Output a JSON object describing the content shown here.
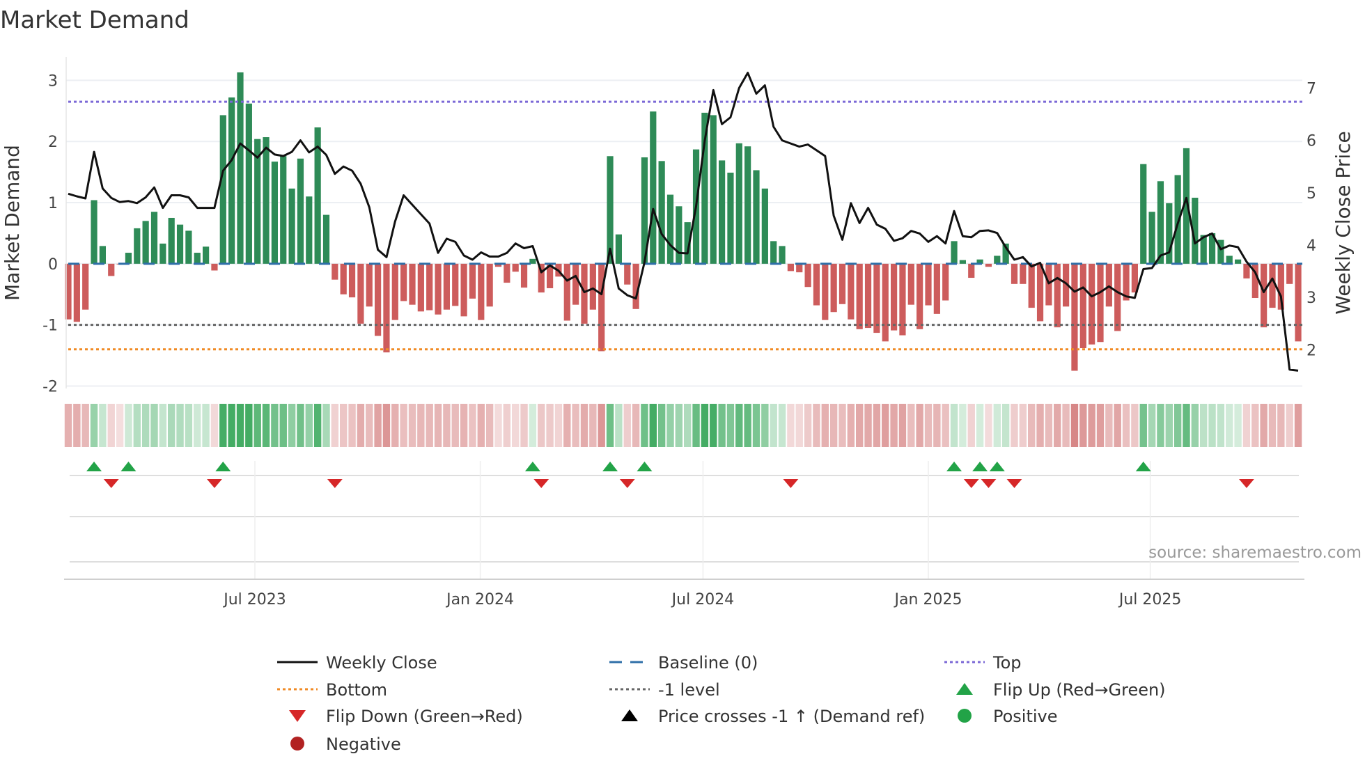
{
  "title": "Market Demand",
  "source": "source: sharemaestro.com",
  "colors": {
    "positive": "#2e8b57",
    "negative": "#cd5c5c",
    "price": "#111111",
    "top": "#7b68d6",
    "bottom": "#f08a24",
    "minus1": "#666666",
    "baseline": "#2f6fa8",
    "flip_up": "#22a347",
    "flip_down": "#d62728",
    "neg_dot": "#b22222"
  },
  "chart_data": {
    "type": "bar",
    "title": "Market Demand",
    "ylabel": "Market Demand",
    "y2label": "Weekly Close Price",
    "ylim": [
      -2.04,
      3.38
    ],
    "y2lim": [
      1.26,
      7.59
    ],
    "yticks": [
      "-2",
      "-1",
      "0",
      "1",
      "2",
      "3"
    ],
    "y2ticks": [
      "2",
      "3",
      "4",
      "5",
      "6",
      "7"
    ],
    "xticks": [
      {
        "label": "Jul 2023",
        "week": 22.7
      },
      {
        "label": "Jan 2024",
        "week": 48.9
      },
      {
        "label": "Jul 2024",
        "week": 74.8
      },
      {
        "label": "Jan 2025",
        "week": 101
      },
      {
        "label": "Jul 2025",
        "week": 126.8
      }
    ],
    "levels": {
      "top": 2.65,
      "baseline": 0,
      "minus1": -1,
      "bottom": -1.4
    },
    "demand": [
      -0.91,
      -0.95,
      -0.75,
      1.04,
      0.29,
      -0.2,
      -0.01,
      0.18,
      0.58,
      0.7,
      0.85,
      0.33,
      0.75,
      0.64,
      0.54,
      0.18,
      0.28,
      -0.11,
      2.43,
      2.72,
      3.13,
      2.62,
      2.04,
      2.07,
      1.67,
      1.76,
      1.23,
      1.72,
      1.1,
      2.23,
      0.8,
      -0.26,
      -0.5,
      -0.55,
      -0.98,
      -0.7,
      -1.18,
      -1.45,
      -0.92,
      -0.61,
      -0.67,
      -0.78,
      -0.76,
      -0.83,
      -0.75,
      -0.69,
      -0.86,
      -0.57,
      -0.92,
      -0.7,
      -0.05,
      -0.31,
      -0.13,
      -0.39,
      0.08,
      -0.47,
      -0.4,
      -0.21,
      -0.93,
      -0.67,
      -0.98,
      -0.75,
      -1.43,
      1.76,
      0.48,
      -0.34,
      -0.74,
      1.74,
      2.49,
      1.68,
      1.13,
      0.94,
      0.68,
      1.87,
      2.47,
      2.43,
      1.69,
      1.49,
      1.97,
      1.92,
      1.53,
      1.23,
      0.37,
      0.29,
      -0.12,
      -0.14,
      -0.38,
      -0.68,
      -0.92,
      -0.79,
      -0.66,
      -0.91,
      -1.07,
      -1.05,
      -1.13,
      -1.27,
      -1.09,
      -1.17,
      -0.67,
      -1.07,
      -0.68,
      -0.82,
      -0.6,
      0.37,
      0.06,
      -0.23,
      0.07,
      -0.05,
      0.13,
      0.33,
      -0.33,
      -0.33,
      -0.72,
      -0.94,
      -0.68,
      -1.04,
      -0.7,
      -1.75,
      -1.38,
      -1.32,
      -1.28,
      -0.7,
      -1.1,
      -0.6,
      -0.47,
      1.63,
      0.85,
      1.35,
      0.99,
      1.45,
      1.89,
      1.08,
      0.47,
      0.5,
      0.39,
      0.13,
      0.07,
      -0.24,
      -0.56,
      -1.04,
      -0.72,
      -0.75,
      -0.33,
      -1.27
    ],
    "price": [
      4.98,
      4.93,
      4.89,
      5.78,
      5.08,
      4.9,
      4.82,
      4.84,
      4.8,
      4.91,
      5.1,
      4.71,
      4.95,
      4.95,
      4.91,
      4.71,
      4.71,
      4.71,
      5.42,
      5.62,
      5.94,
      5.81,
      5.67,
      5.86,
      5.73,
      5.7,
      5.78,
      6.0,
      5.77,
      5.88,
      5.72,
      5.36,
      5.5,
      5.42,
      5.17,
      4.72,
      3.91,
      3.77,
      4.45,
      4.95,
      4.77,
      4.59,
      4.41,
      3.85,
      4.12,
      4.06,
      3.8,
      3.72,
      3.86,
      3.78,
      3.78,
      3.85,
      4.03,
      3.94,
      3.98,
      3.48,
      3.61,
      3.51,
      3.32,
      3.41,
      3.1,
      3.17,
      3.06,
      3.93,
      3.17,
      3.04,
      2.98,
      3.67,
      4.69,
      4.21,
      4.0,
      3.85,
      3.84,
      4.74,
      5.99,
      6.96,
      6.31,
      6.44,
      7.0,
      7.29,
      6.89,
      7.05,
      6.26,
      6.0,
      5.94,
      5.88,
      5.92,
      5.81,
      5.7,
      4.56,
      4.1,
      4.8,
      4.42,
      4.71,
      4.39,
      4.31,
      4.08,
      4.13,
      4.27,
      4.22,
      4.06,
      4.17,
      4.03,
      4.65,
      4.17,
      4.15,
      4.27,
      4.28,
      4.23,
      3.96,
      3.72,
      3.77,
      3.59,
      3.66,
      3.27,
      3.37,
      3.27,
      3.11,
      3.19,
      3.02,
      3.1,
      3.21,
      3.1,
      3.02,
      2.99,
      3.54,
      3.56,
      3.8,
      3.86,
      4.41,
      4.9,
      4.03,
      4.15,
      4.22,
      3.92,
      3.99,
      3.96,
      3.68,
      3.48,
      3.1,
      3.36,
      3.02,
      1.62,
      1.6
    ],
    "legend": {
      "placement": "bottom",
      "items": [
        {
          "label": "Weekly Close",
          "marker": "line"
        },
        {
          "label": "Baseline (0)",
          "marker": "dash"
        },
        {
          "label": "Top",
          "marker": "dot-line"
        },
        {
          "label": "Bottom",
          "marker": "dot-line"
        },
        {
          "label": "-1 level",
          "marker": "dot-line"
        },
        {
          "label": "Flip Up (Red→Green)",
          "marker": "triangle-up"
        },
        {
          "label": "Flip Down (Green→Red)",
          "marker": "triangle-down"
        },
        {
          "label": "Price crosses -1 ↑ (Demand ref)",
          "marker": "triangle-up-black"
        },
        {
          "label": "Positive",
          "marker": "circle-green"
        },
        {
          "label": "Negative",
          "marker": "circle-red"
        }
      ]
    }
  }
}
